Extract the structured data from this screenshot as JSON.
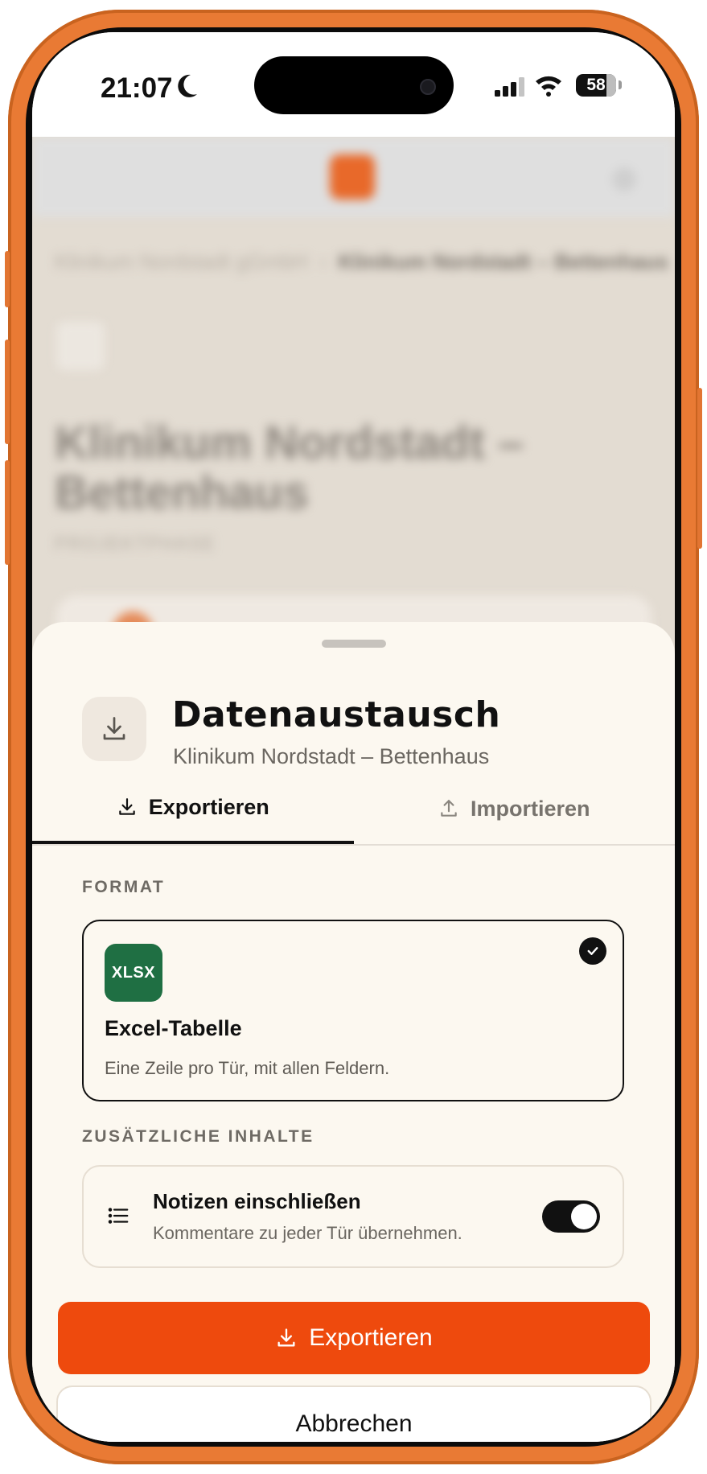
{
  "status_bar": {
    "time": "21:07",
    "battery": "58"
  },
  "background_app": {
    "breadcrumb_parent": "Klinikum Nordstadt gGmbH",
    "breadcrumb_separator": "›",
    "breadcrumb_current": "Klinikum Nordstadt – Bettenhaus",
    "title": "Klinikum Nordstadt – Bettenhaus",
    "subtitle": "PROJEKTPHASE"
  },
  "sheet": {
    "title": "Datenaustausch",
    "subtitle": "Klinikum Nordstadt – Bettenhaus",
    "header_icon": "download-icon",
    "tabs": [
      {
        "label": "Exportieren",
        "icon": "download-icon",
        "active": true
      },
      {
        "label": "Importieren",
        "icon": "upload-icon",
        "active": false
      }
    ],
    "format_section_label": "FORMAT",
    "format": {
      "badge": "XLSX",
      "name": "Excel-Tabelle",
      "description": "Eine Zeile pro Tür, mit allen Feldern.",
      "selected": true
    },
    "extra_section_label": "ZUSÄTZLICHE INHALTE",
    "notes": {
      "title": "Notizen einschließen",
      "description": "Kommentare zu jeder Tür übernehmen.",
      "enabled": true
    },
    "primary_button": "Exportieren",
    "cancel_button": "Abbrechen"
  },
  "colors": {
    "accent": "#ee4a0d",
    "excel_green": "#1f6f43",
    "sheet_bg": "#fcf8f0",
    "phone_frame": "#e97a34"
  }
}
